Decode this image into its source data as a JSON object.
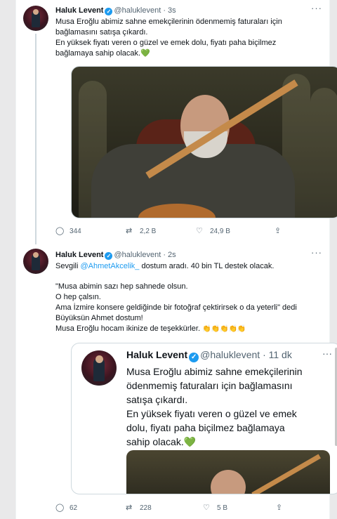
{
  "tweet1": {
    "name": "Haluk Levent",
    "handle": "@haluklevent · 3s",
    "text_lines": [
      "Musa Eroğlu abimiz sahne emekçilerinin ödenmemiş faturaları için",
      "bağlamasını satışa çıkardı.",
      "En yüksek fiyatı veren o güzel ve emek dolu, fiyatı paha biçilmez",
      "bağlamaya sahip olacak."
    ],
    "heart_emoji": "💚",
    "actions": {
      "replies": "344",
      "retweets": "2,2 B",
      "likes": "24,9 B"
    }
  },
  "tweet2": {
    "name": "Haluk Levent",
    "handle": "@haluklevent · 2s",
    "line1_pre": "Sevgili ",
    "mention": "@AhmetAkcelik_",
    "line1_post": " dostum aradı. 40 bin TL destek olacak.",
    "text_lines": [
      "\"Musa abimin sazı hep sahnede olsun.",
      "O hep çalsın.",
      "Ama İzmire konsere geldiğinde bir fotoğraf çektirirsek o da yeterli\" dedi",
      "Büyüksün Ahmet dostum!"
    ],
    "thanks": "Musa Eroğlu hocam ikinize de teşekkürler.",
    "claps": "👏👏👏👏👏",
    "actions": {
      "replies": "62",
      "retweets": "228",
      "likes": "5 B"
    }
  },
  "quote": {
    "name": "Haluk Levent",
    "handle": "@haluklevent · 11 dk",
    "text_lines": [
      "Musa Eroğlu abimiz sahne emekçilerinin",
      "ödenmemiş faturaları için bağlamasını",
      "satışa çıkardı.",
      "En yüksek fiyatı veren o güzel ve emek",
      "dolu, fiyatı paha biçilmez bağlamaya",
      "sahip olacak."
    ],
    "heart_emoji": "💚"
  },
  "icons": {
    "more": "···",
    "reply": "◯",
    "retweet": "⇄",
    "like": "♡",
    "share": "⇪",
    "verified": "✓"
  },
  "colors": {
    "accent": "#1d9bf0",
    "text": "#0f1419",
    "muted": "#536471"
  }
}
